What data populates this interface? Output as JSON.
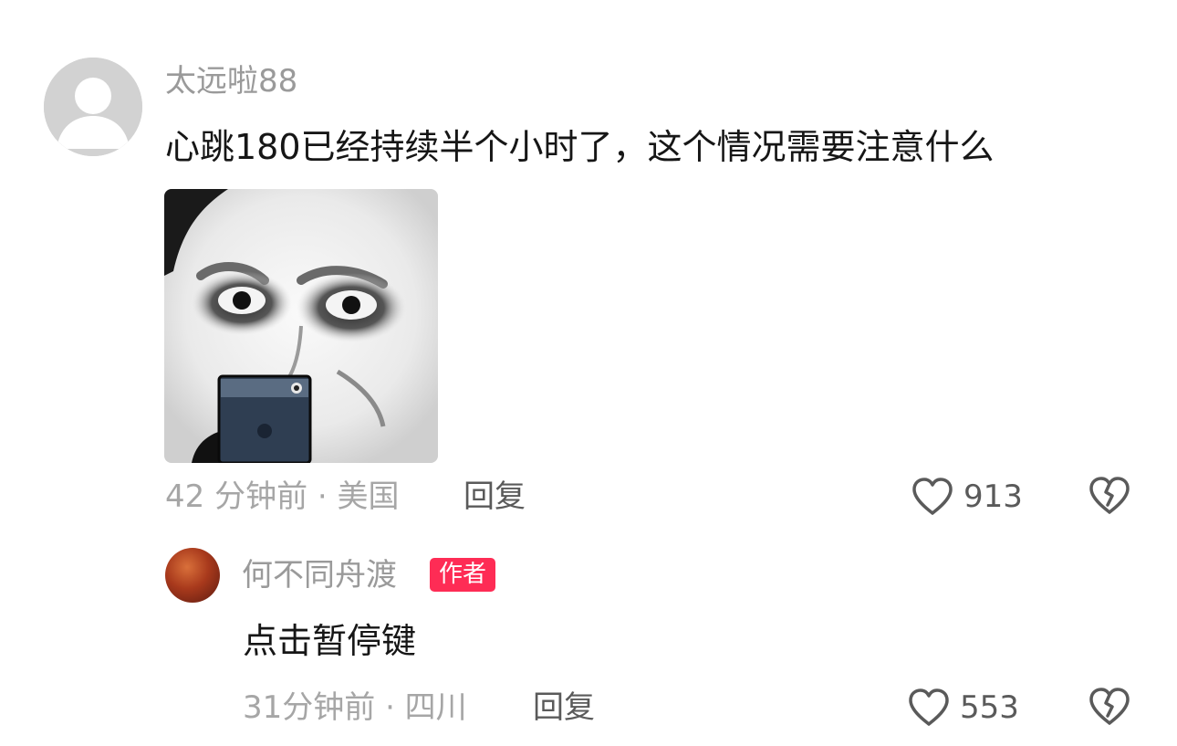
{
  "main_comment": {
    "username": "太远啦88",
    "text": "心跳180已经持续半个小时了，这个情况需要注意什么",
    "meta": "42 分钟前 · 美国",
    "reply_label": "回复",
    "like_count": "913",
    "avatar_icon": "default-user-avatar",
    "image_icon": "meme-face-with-phone"
  },
  "reply_comment": {
    "username": "何不同舟渡",
    "badge": "作者",
    "avatar_signature": "何不同舟渡",
    "text": "点击暂停键",
    "meta": "31分钟前 · 四川",
    "reply_label": "回复",
    "like_count": "553"
  },
  "icons": {
    "like": "heart-outline-icon",
    "dislike": "broken-heart-icon"
  },
  "colors": {
    "badge": "#fe2c55",
    "username": "#9a9a9a",
    "text": "#161616",
    "meta": "#a6a6a6",
    "action": "#5a5a5a"
  }
}
